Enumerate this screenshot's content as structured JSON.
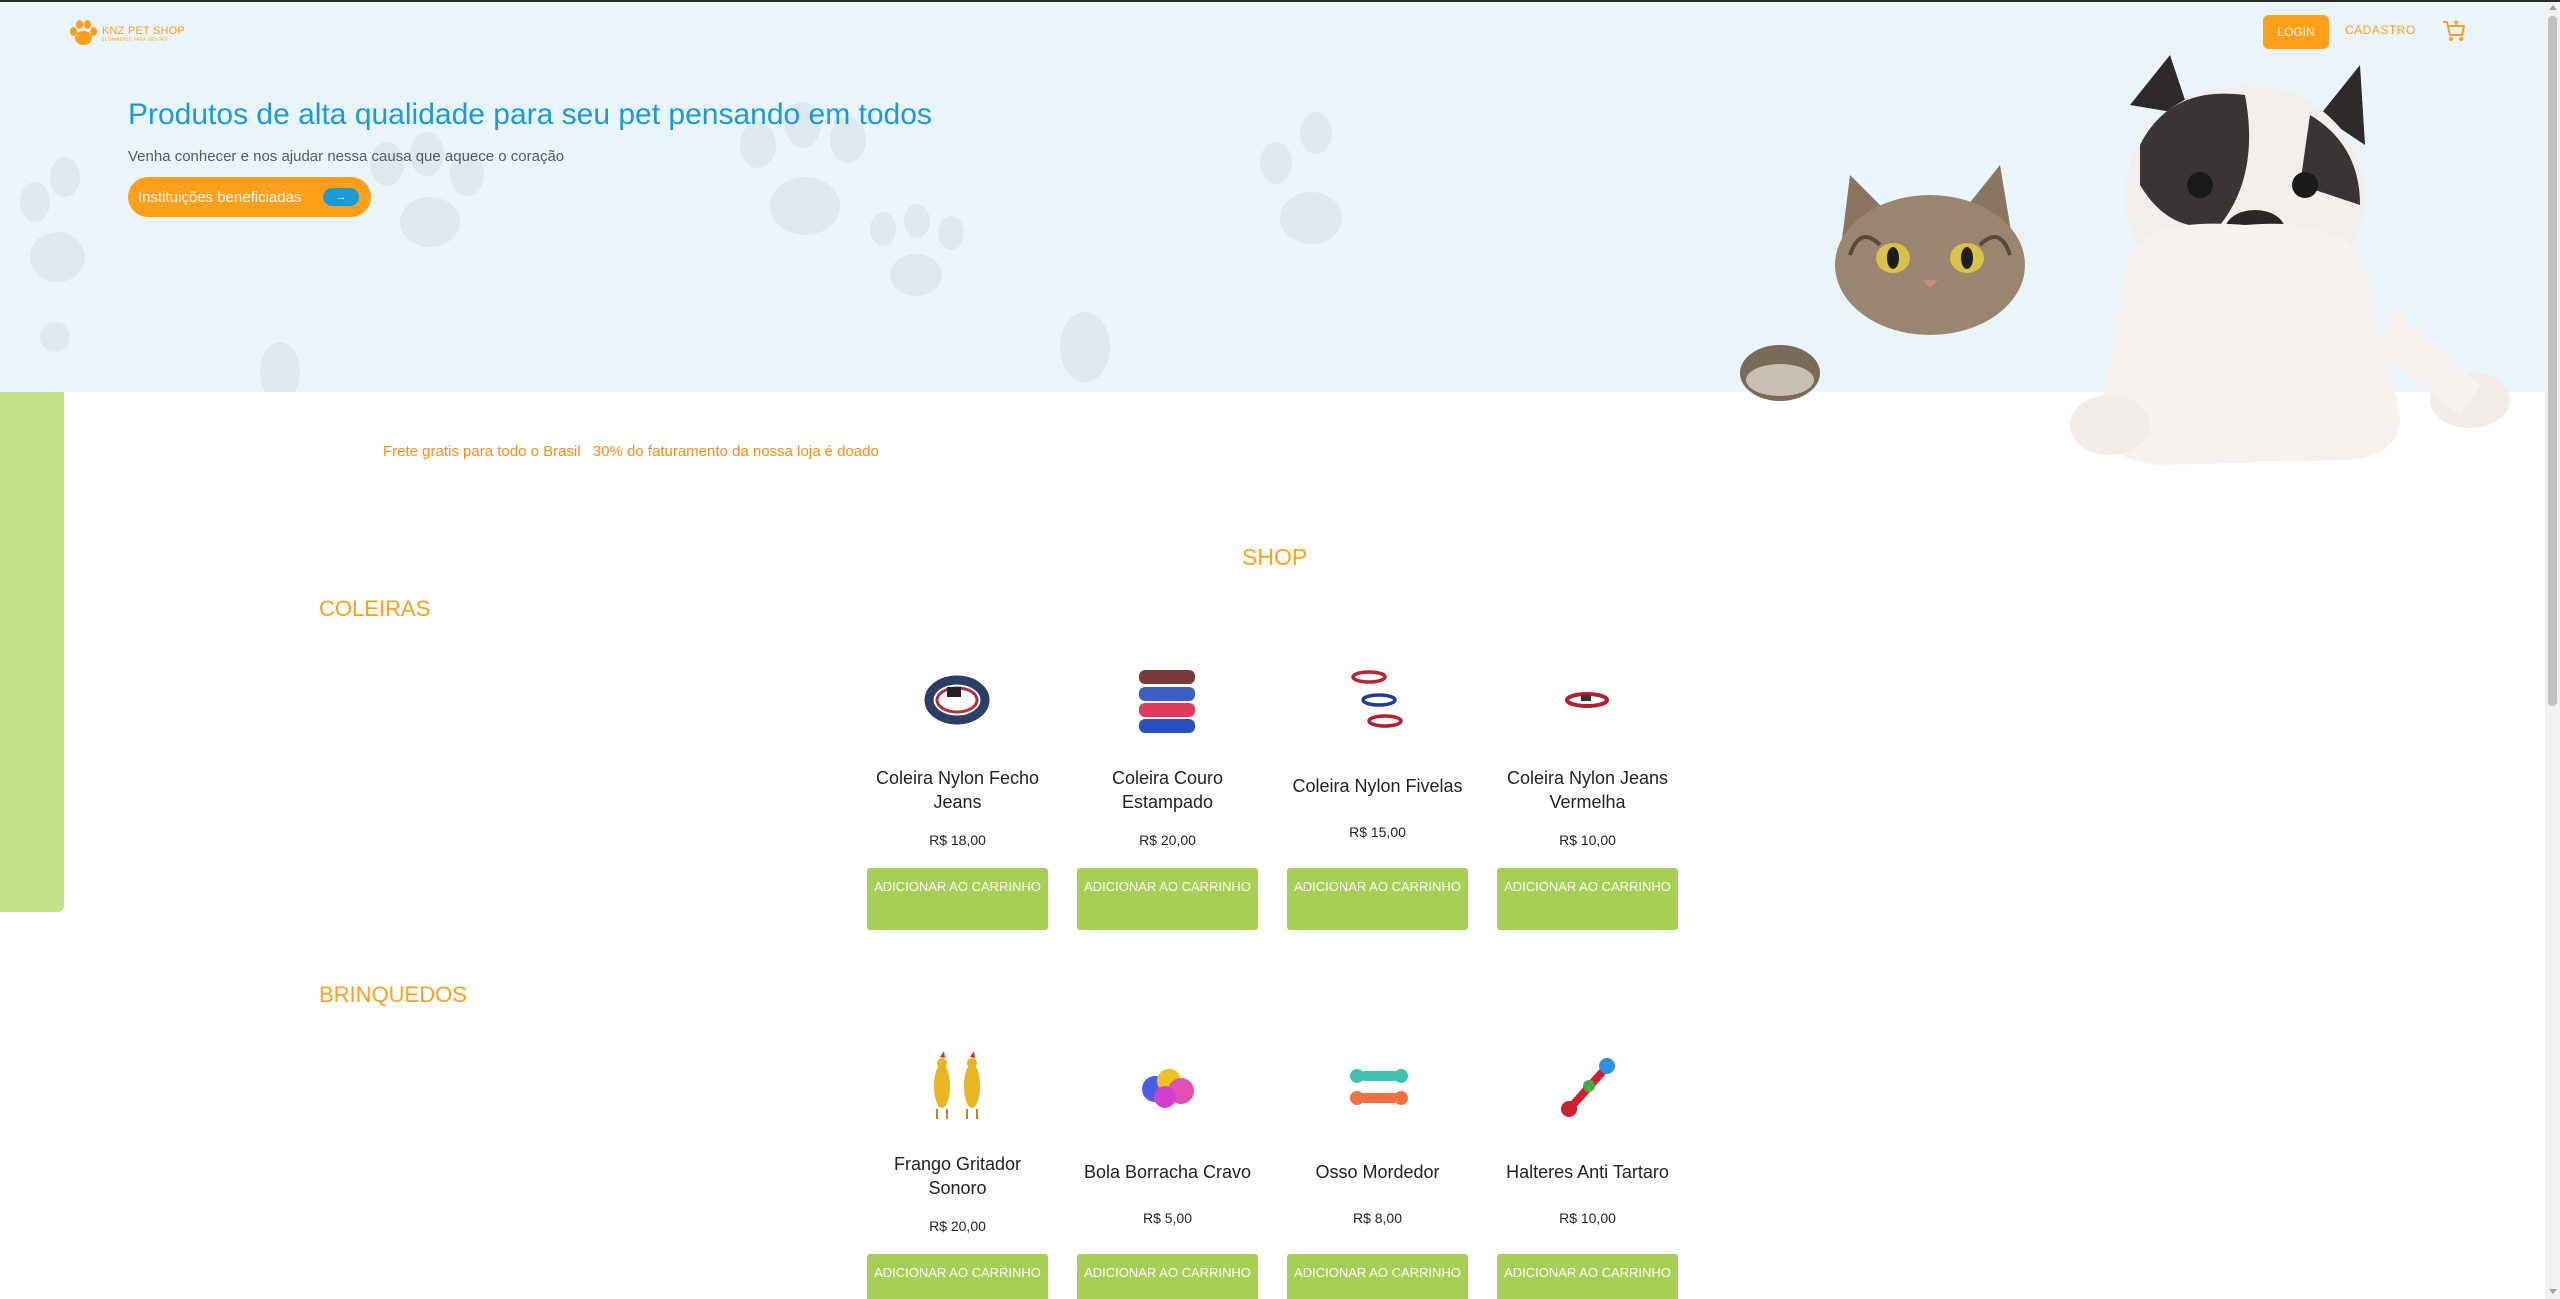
{
  "header": {
    "logo_name": "KNZ PET SHOP",
    "logo_tagline": "ECOMMERCE PARA SEU PET",
    "login_label": "LOGIN",
    "signup_label": "CADASTRO"
  },
  "hero": {
    "title": "Produtos de alta qualidade para seu pet pensando em todos",
    "subtitle": "Venha conhecer e nos ajudar nessa causa que aquece o coração",
    "button_label": "Instituições beneficiadas",
    "button_arrow": "→"
  },
  "promo": {
    "free_shipping": "Frete gratis para todo o Brasil",
    "donation": "30% do faturamento da nossa loja é doado"
  },
  "shop": {
    "title": "SHOP",
    "add_to_cart_label": "ADICIONAR AO CARRINHO",
    "categories": [
      {
        "title": "COLEIRAS",
        "products": [
          {
            "name": "Coleira Nylon Fecho Jeans",
            "price": "R$ 18,00"
          },
          {
            "name": "Coleira Couro Estampado",
            "price": "R$ 20,00"
          },
          {
            "name": "Coleira Nylon Fivelas",
            "price": "R$ 15,00"
          },
          {
            "name": "Coleira Nylon Jeans Vermelha",
            "price": "R$ 10,00"
          }
        ]
      },
      {
        "title": "BRINQUEDOS",
        "products": [
          {
            "name": "Frango Gritador Sonoro",
            "price": "R$ 20,00"
          },
          {
            "name": "Bola Borracha Cravo",
            "price": "R$ 5,00"
          },
          {
            "name": "Osso Mordedor",
            "price": "R$ 8,00"
          },
          {
            "name": "Halteres Anti Tartaro",
            "price": "R$ 10,00"
          }
        ]
      }
    ]
  },
  "colors": {
    "orange": "#ff9f1a",
    "blue": "#1a9bd7",
    "green_button": "#a8cf55",
    "hero_bg": "#e9f5fb"
  },
  "icons": [
    "paw-logo-icon",
    "cart-icon",
    "arrow-right-icon"
  ]
}
